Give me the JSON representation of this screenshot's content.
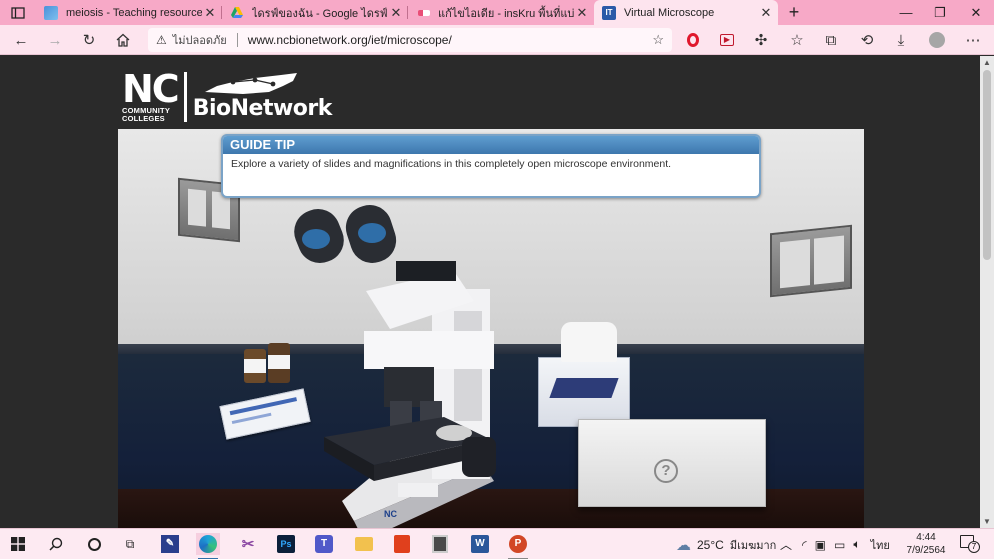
{
  "browser": {
    "tabs": [
      {
        "title": "meiosis - Teaching resources",
        "active": false
      },
      {
        "title": "ไดรฟ์ของฉัน - Google ไดรฟ์",
        "active": false
      },
      {
        "title": "แก้ไขไอเดีย - insKru พื้นที่แบ่งปันไอเดี",
        "active": false
      },
      {
        "title": "Virtual Microscope",
        "active": true
      }
    ],
    "new_tab_label": "+",
    "address": {
      "security_label": "ไม่ปลอดภัย",
      "url": "www.ncbionetwork.org/iet/microscope/"
    }
  },
  "page": {
    "logo": {
      "nc": "NC",
      "community_colleges": [
        "COMMUNITY",
        "COLLEGES"
      ],
      "bionetwork": "BioNetwork"
    },
    "guide_tip": {
      "heading": "GUIDE TIP",
      "text": "Explore a variety of slides and magnifications in this completely open microscope environment."
    },
    "help_button": "?",
    "scene_labels": {
      "microscope_badge": "NC"
    }
  },
  "taskbar": {
    "weather": "25°C",
    "weather_desc": "มีเมฆมาก",
    "language": "ไทย",
    "time": "4:44",
    "date": "7/9/2564",
    "notification_count": "7"
  },
  "colors": {
    "tab_strip": "#f7a9c7",
    "toolbar": "#fde4ee",
    "guide_header": "#3d77ad"
  }
}
